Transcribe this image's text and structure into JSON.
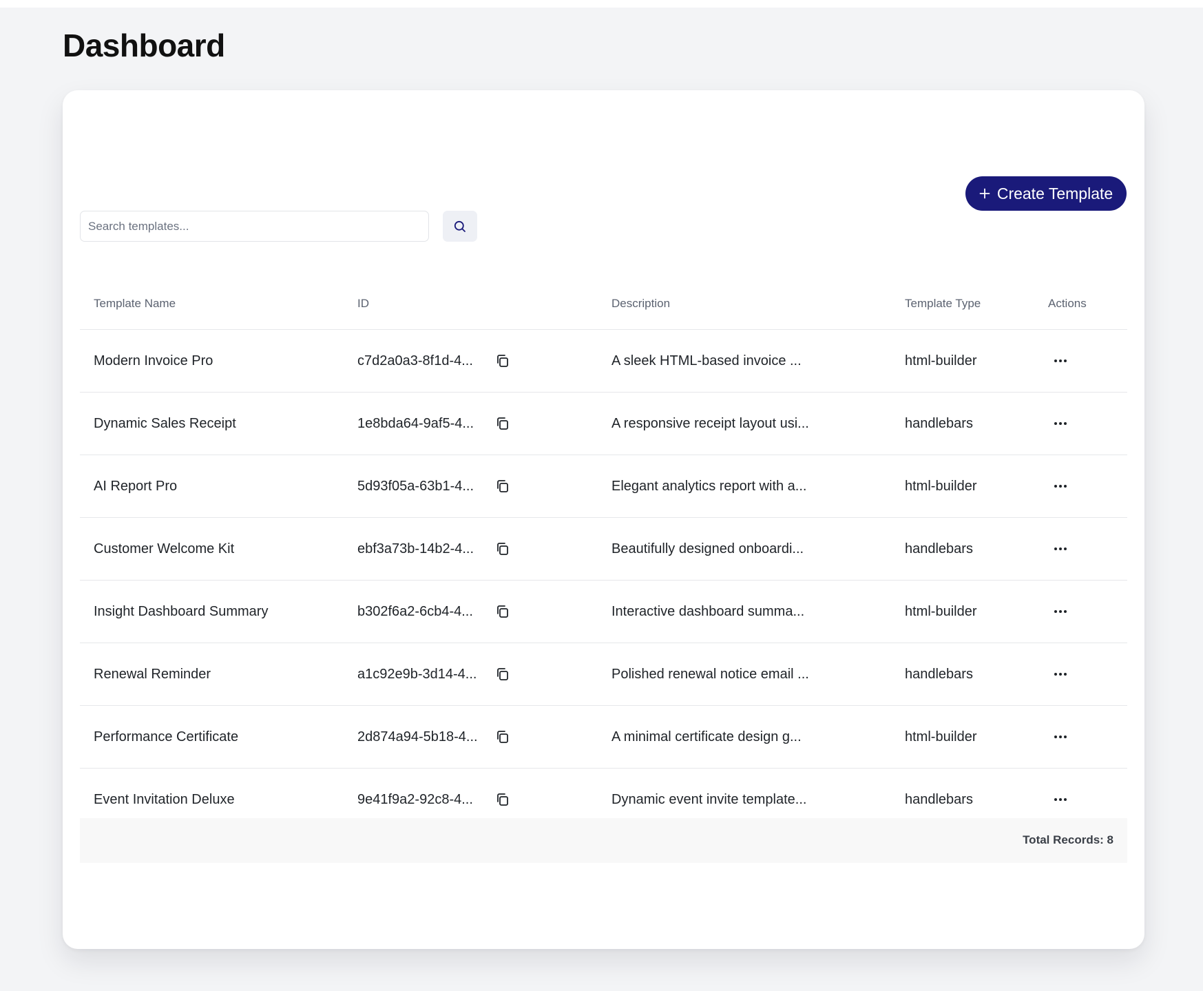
{
  "page": {
    "title": "Dashboard"
  },
  "toolbar": {
    "create_label": "Create Template",
    "search_placeholder": "Search templates...",
    "search_value": ""
  },
  "table": {
    "columns": [
      "Template Name",
      "ID",
      "Description",
      "Template Type",
      "Actions"
    ],
    "rows": [
      {
        "name": "Modern Invoice Pro",
        "id": "c7d2a0a3-8f1d-4...",
        "description": "A sleek HTML-based invoice ...",
        "type": "html-builder"
      },
      {
        "name": "Dynamic Sales Receipt",
        "id": "1e8bda64-9af5-4...",
        "description": "A responsive receipt layout usi...",
        "type": "handlebars"
      },
      {
        "name": "AI Report Pro",
        "id": "5d93f05a-63b1-4...",
        "description": "Elegant analytics report with a...",
        "type": "html-builder"
      },
      {
        "name": "Customer Welcome Kit",
        "id": "ebf3a73b-14b2-4...",
        "description": "Beautifully designed onboardi...",
        "type": "handlebars"
      },
      {
        "name": "Insight Dashboard Summary",
        "id": "b302f6a2-6cb4-4...",
        "description": "Interactive dashboard summa...",
        "type": "html-builder"
      },
      {
        "name": "Renewal Reminder",
        "id": "a1c92e9b-3d14-4...",
        "description": "Polished renewal notice email ...",
        "type": "handlebars"
      },
      {
        "name": "Performance Certificate",
        "id": "2d874a94-5b18-4...",
        "description": "A minimal certificate design g...",
        "type": "html-builder"
      },
      {
        "name": "Event Invitation Deluxe",
        "id": "9e41f9a2-92c8-4...",
        "description": "Dynamic event invite template...",
        "type": "handlebars"
      }
    ],
    "total_label": "Total Records: 8"
  },
  "icons": {
    "plus": "plus-icon",
    "search": "search-icon",
    "copy": "copy-icon",
    "actions": "more-horizontal-icon"
  },
  "colors": {
    "primary": "#1a1a7a",
    "page_background": "#f3f4f6",
    "card_background": "#ffffff"
  }
}
